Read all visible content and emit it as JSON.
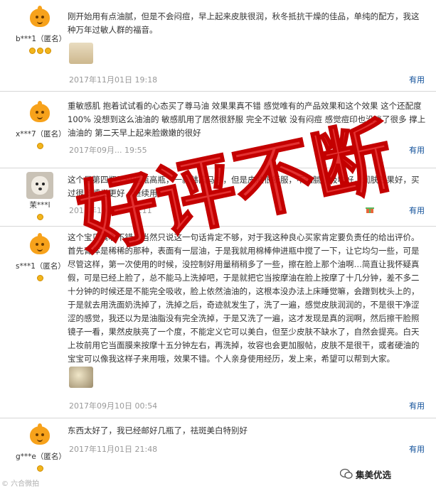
{
  "stamp_text": "好评不断",
  "useful_label": "有用",
  "reviews": [
    {
      "user": "b***1（匿名）",
      "medals": 3,
      "avatar": "orange-mascot-icon",
      "text": "刚开始用有点油腻，但是不会闷痘，早上起来皮肤很润，秋冬抵抗干燥的佳品，单纯的配方，我这种万年过敏人群的福音。",
      "date": "2017年11月01日 19:18",
      "useful": "有用"
    },
    {
      "user": "x***7（匿名）",
      "medals": 1,
      "avatar": "orange-mascot-icon",
      "text": "重敏感肌 抱着试试看的心态买了尊马油 效果果真不错 感觉唯有的产品效果和这个效果 这个还配度100% 没想到这么油油的 敏感肌用了居然很舒服 完全不过敏 没有闷痘 感觉痘印也没淡了很多 撑上油油的 第二天早上起来脸嫩嫩的很好",
      "date": "2017年09月... 19:55",
      "useful": "有用"
    },
    {
      "user": "茉***l",
      "medals": 1,
      "avatar": "dog-photo-icon",
      "text": "这个是第四瓶了过四瓶高瓶，一款韩国马油，但是皮肤很舒服，不油腻，吸收好，润肤效果好，买过很多感觉更好，继续用。",
      "date": "2017年10月0... 10:11",
      "useful": ""
    },
    {
      "user": "s***1（匿名）",
      "medals": 1,
      "avatar": "orange-mascot-icon",
      "text": "这个宝贝真心不错，当然只说这一句话肯定不够，对于我这种良心买家肯定要负责任的给出评价。首先膏体是稀稀的那种，表面有一层油，于是我就用棉棒伸进瓶中搅了一下，让它均匀一些，可是尽管这样，第一次使用的时候，没控制好用量稍稍多了一些，擦在脸上那个油啊…简直让我怀疑真假，可是已经上脸了，总不能马上洗掉吧，于是就把它当按摩油在脸上按摩了十几分钟，差不多二十分钟的时候还是不能完全吸收，脸上依然油油的，这根本没办法上床睡觉嘛，会蹭到枕头上的，于是就去用洗面奶洗掉了，洗掉之后，奇迹就发生了，洗了一遍，感觉皮肤润润的，不是很干净涩涩的感觉，我还以为是油脂没有完全洗掉，于是又洗了一遍，这才发现是真的润啊，然后擦干脸照镜子一看，果然皮肤亮了一个度，不能定义它可以美白，但至少皮肤不缺水了，自然会提亮。白天上妆前用它当面膜来按摩十五分钟左右，再洗掉，妆容也会更加服帖，皮肤不是很干，或者硬油的宝宝可以像我这样子来用哦，效果不错。个人亲身使用经历，发上来，希望可以帮到大家。",
      "date": "2017年09月10日 00:54",
      "useful": "有用"
    },
    {
      "user": "g***e（匿名）",
      "medals": 1,
      "avatar": "orange-mascot-icon",
      "text": "东西太好了，我已经邮好几瓶了，祛斑美白特别好",
      "date": "2017年11月01日 21:48",
      "useful": "有用"
    }
  ],
  "watermark_left": "© 六合微拍",
  "watermark_right": "集美优选"
}
